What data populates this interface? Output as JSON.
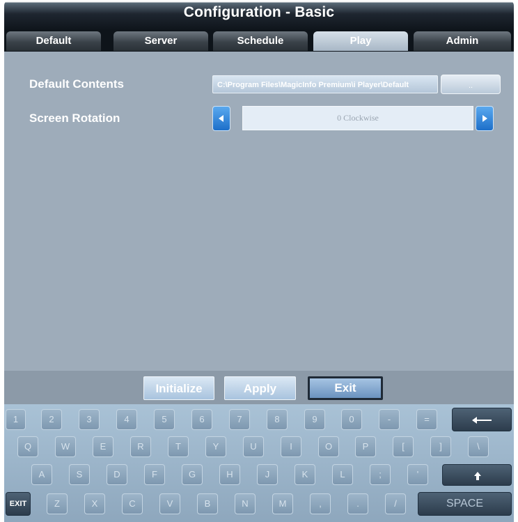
{
  "window": {
    "title": "Configuration - Basic"
  },
  "tabs": [
    {
      "label": "Default",
      "active": false
    },
    {
      "label": "Server",
      "active": false
    },
    {
      "label": "Schedule",
      "active": false
    },
    {
      "label": "Play",
      "active": true
    },
    {
      "label": "Admin",
      "active": false
    }
  ],
  "settings": {
    "default_contents": {
      "label": "Default Contents",
      "value": "C:\\Program Files\\MagicInfo Premium\\i Player\\Default",
      "browse_label": ".."
    },
    "screen_rotation": {
      "label": "Screen Rotation",
      "value": "0 Clockwise",
      "prev_icon": "arrow-left-icon",
      "next_icon": "arrow-right-icon"
    }
  },
  "actions": {
    "initialize": "Initialize",
    "apply": "Apply",
    "exit": "Exit"
  },
  "keyboard": {
    "row1": [
      "1",
      "2",
      "3",
      "4",
      "5",
      "6",
      "7",
      "8",
      "9",
      "0",
      "-",
      "="
    ],
    "backspace_icon": "backspace-arrow-icon",
    "row2": [
      "Q",
      "W",
      "E",
      "R",
      "T",
      "Y",
      "U",
      "I",
      "O",
      "P",
      "[",
      "]",
      "\\"
    ],
    "row3": [
      "A",
      "S",
      "D",
      "F",
      "G",
      "H",
      "J",
      "K",
      "L",
      ";",
      "'"
    ],
    "shift_icon": "shift-up-arrow-icon",
    "exit_label": "EXIT",
    "row4": [
      "Z",
      "X",
      "C",
      "V",
      "B",
      "N",
      "M",
      ",",
      ".",
      "/"
    ],
    "space_label": "SPACE"
  },
  "colors": {
    "accent_blue": "#2a7fd8",
    "panel": "#9eacba",
    "titlebar": "#0e141a"
  }
}
